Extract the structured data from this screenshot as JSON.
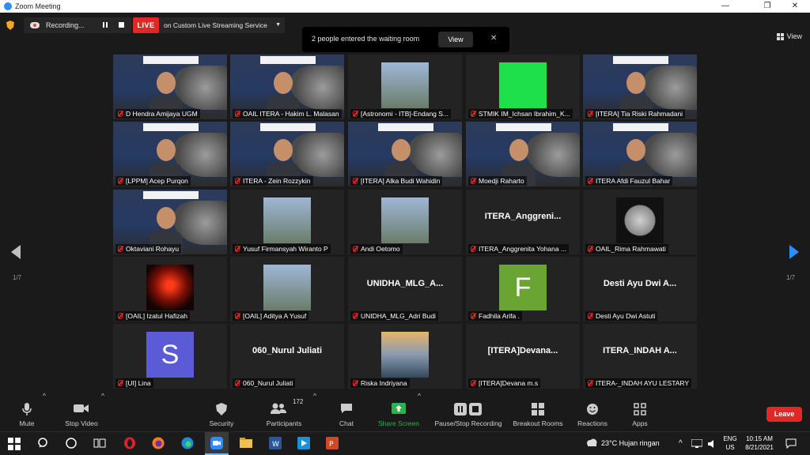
{
  "window": {
    "title": "Zoom Meeting",
    "minimize": "—",
    "maximize": "❐",
    "close": "✕"
  },
  "topbar": {
    "recording_label": "Recording...",
    "live_badge": "LIVE",
    "stream_label": "on Custom Live Streaming Service",
    "view_label": "View"
  },
  "notification": {
    "message": "2 people entered the waiting room",
    "view_button": "View",
    "close": "✕"
  },
  "pagination": {
    "left": "1/7",
    "right": "1/7"
  },
  "tiles": [
    {
      "name": "D Hendra Amijaya UGM",
      "kind": "video-bg"
    },
    {
      "name": "OAIL ITERA - Hakim L. Malasan",
      "kind": "video-bg"
    },
    {
      "name": "[Astronomi - ITB]-Endang S...",
      "kind": "photo"
    },
    {
      "name": "STMIK IM_Ichsan Ibrahim_K...",
      "kind": "green"
    },
    {
      "name": "[ITERA] Tia Riski Rahmadani",
      "kind": "video-bg"
    },
    {
      "name": "[LPPM] Acep Purqon",
      "kind": "video-bg",
      "active": true
    },
    {
      "name": "ITERA - Zein Rozzykin",
      "kind": "video-bg"
    },
    {
      "name": "[ITERA] Alka Budi Wahidin",
      "kind": "video-bg"
    },
    {
      "name": "Moedji Raharto",
      "kind": "video-bg"
    },
    {
      "name": "ITERA Afdi Fauzul Bahar",
      "kind": "video-bg"
    },
    {
      "name": "Oktaviani Rohayu",
      "kind": "video-bg"
    },
    {
      "name": "Yusuf Firmansyah Wiranto P",
      "kind": "photo"
    },
    {
      "name": "Andi Oetomo",
      "kind": "photo"
    },
    {
      "name": "ITERA_Anggrenita Yohana ...",
      "kind": "text",
      "display": "ITERA_Anggreni..."
    },
    {
      "name": "OAIL_Rima Rahmawati",
      "kind": "moon"
    },
    {
      "name": "[OAIL] Izatul Hafizah",
      "kind": "sunset"
    },
    {
      "name": "[OAIL] Aditya A Yusuf",
      "kind": "photo"
    },
    {
      "name": "UNIDHA_MLG_Adri Budi",
      "kind": "text",
      "display": "UNIDHA_MLG_A..."
    },
    {
      "name": "Fadhila Arifa .",
      "kind": "letter",
      "display": "F",
      "color": "#6aa534"
    },
    {
      "name": "Desti Ayu Dwi Astuti",
      "kind": "text",
      "display": "Desti Ayu Dwi A..."
    },
    {
      "name": "[UI] Lina",
      "kind": "letter",
      "display": "S",
      "color": "#5b5bd6"
    },
    {
      "name": "060_Nurul Juliati",
      "kind": "text",
      "display": "060_Nurul Juliati"
    },
    {
      "name": "Riska Indriyana",
      "kind": "sea"
    },
    {
      "name": "[ITERA]Devana m.s",
      "kind": "text",
      "display": "[ITERA]Devana..."
    },
    {
      "name": "ITERA-_INDAH AYU LESTARY",
      "kind": "text",
      "display": "ITERA_INDAH A..."
    }
  ],
  "toolbar": {
    "mute": "Mute",
    "stop_video": "Stop Video",
    "security": "Security",
    "participants": "Participants",
    "participant_count": "172",
    "chat": "Chat",
    "share_screen": "Share Screen",
    "recording": "Pause/Stop Recording",
    "breakout": "Breakout Rooms",
    "reactions": "Reactions",
    "apps": "Apps",
    "leave": "Leave"
  },
  "taskbar": {
    "weather": "23°C  Hujan ringan",
    "lang_top": "ENG",
    "lang_bottom": "US",
    "time": "10:15 AM",
    "date": "8/21/2021"
  },
  "colors": {
    "share_green": "#2bb24c",
    "live_red": "#e02828",
    "leave_red": "#e02828",
    "accent_blue": "#2d8cff",
    "active_outline": "#d9e04a"
  }
}
